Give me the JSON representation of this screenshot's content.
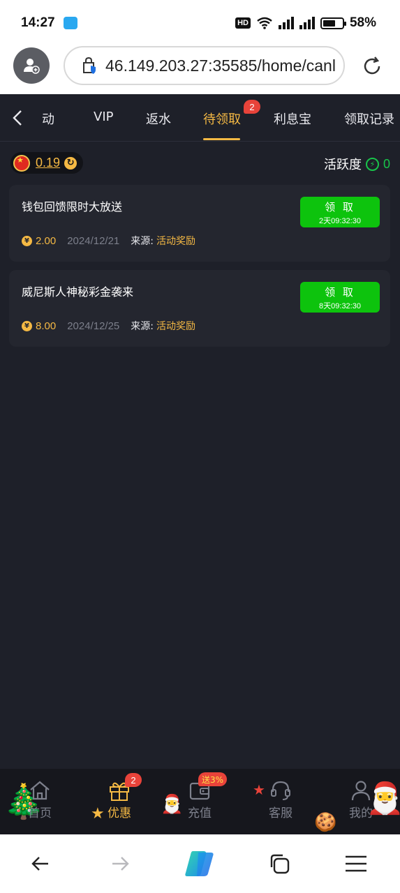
{
  "status": {
    "time": "14:27",
    "hd": "HD",
    "net1": "5G",
    "net2": "4G",
    "battery": "58%"
  },
  "browser": {
    "url": "46.149.203.27:35585/home/canl"
  },
  "tabs": [
    {
      "label": "动"
    },
    {
      "label": "VIP"
    },
    {
      "label": "返水"
    },
    {
      "label": "待领取"
    },
    {
      "label": "利息宝"
    },
    {
      "label": "领取记录"
    }
  ],
  "tab_badge": "2",
  "balance": {
    "value": "0.19"
  },
  "activity": {
    "label": "活跃度",
    "value": "0"
  },
  "rewards": [
    {
      "title": "钱包回馈限时大放送",
      "claim_label": "领 取",
      "timer": "2天09:32:30",
      "amount": "2.00",
      "date": "2024/12/21",
      "source_label": "来源:",
      "source_value": "活动奖励"
    },
    {
      "title": "威尼斯人神秘彩金袭来",
      "claim_label": "领 取",
      "timer": "8天09:32:30",
      "amount": "8.00",
      "date": "2024/12/25",
      "source_label": "来源:",
      "source_value": "活动奖励"
    }
  ],
  "nav": {
    "home": "首页",
    "offers": "优惠",
    "offers_badge": "2",
    "deposit": "充值",
    "deposit_promo": "送3%",
    "service": "客服",
    "mine": "我的"
  },
  "colors": {
    "accent": "#f5b944",
    "claim_green": "#0dc30d",
    "badge_red": "#e8433a",
    "background": "#1e2029"
  }
}
